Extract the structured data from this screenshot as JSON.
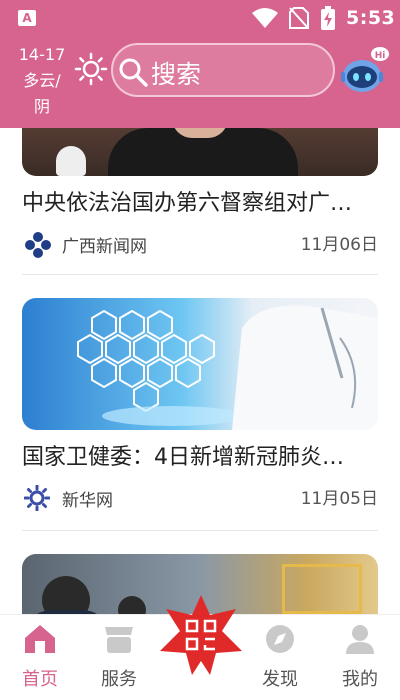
{
  "status": {
    "time": "5:53",
    "left_icon": "A"
  },
  "header": {
    "weather_temp": "14-17",
    "weather_desc1": "多云/",
    "weather_desc2": "阴",
    "search_placeholder": "搜索",
    "assistant_badge": "Hi"
  },
  "news": [
    {
      "title": "中央依法治国办第六督察组对广…",
      "source": "广西新闻网",
      "date": "11月06日"
    },
    {
      "title": "国家卫健委：4日新增新冠肺炎…",
      "source": "新华网",
      "date": "11月05日"
    }
  ],
  "nav": {
    "home": "首页",
    "service": "服务",
    "discover": "发现",
    "mine": "我的"
  },
  "colors": {
    "brand": "#d6648f",
    "center_button": "#e02a2a"
  }
}
